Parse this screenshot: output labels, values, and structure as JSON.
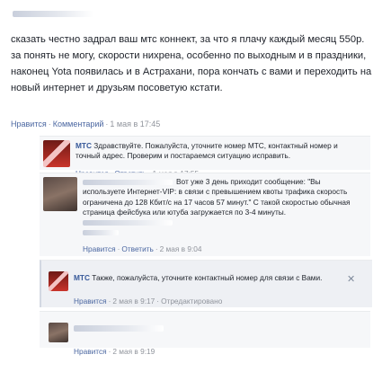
{
  "post": {
    "text": "сказать честно задрал ваш мтс коннект, за что я плачу каждый месяц 550р. за понять не могу, скорости нихрена, особенно по выходным и в праздники, наконец Yota появилась и в Астрахани, пора кончать с вами и переходить на новый интернет и друзьям посоветую кстати.",
    "like": "Нравится",
    "comment": "Комментарий",
    "time": "1 мая в 17:45"
  },
  "comments": [
    {
      "author": "МТС",
      "text": "Здравствуйте. Пожалуйста, уточните номер МТС, контактный номер и точный адрес. Проверим и постараемся ситуацию исправить.",
      "like": "Нравится",
      "reply": "Ответить",
      "time": "1 мая в 17:55"
    },
    {
      "text": "Вот уже 3 день приходит сообщение: \"Вы используете Интернет-VIP: в связи с превышением квоты трафика скорость ограничена до 128 Кбит/с на 17 часов 57 минут.\" С такой скоростью обычная страница фейсбука или ютуба загружается по 3-4 минуты.",
      "like": "Нравится",
      "reply": "Ответить",
      "time": "2 мая в 9:04"
    },
    {
      "author": "МТС",
      "text": "Также, пожалуйста, уточните контактный номер для связи с Вами.",
      "like": "Нравится",
      "time": "2 мая в 9:17",
      "edited": "Отредактировано",
      "close_icon": "✕"
    },
    {
      "like": "Нравится",
      "time": "2 мая в 9:19"
    }
  ],
  "separator": "·",
  "icons": {
    "close": "close-icon",
    "cursor": "mouse-cursor-icon"
  }
}
